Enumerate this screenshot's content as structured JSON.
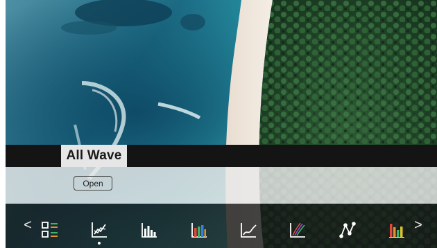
{
  "tile": {
    "title": "All Wave",
    "open_label": "Open"
  },
  "navigation": {
    "prev_label": "<",
    "next_label": ">"
  },
  "toolbar": {
    "selected_index": 1,
    "icons": [
      "list-view-icon",
      "line-chart-icon",
      "bar-chart-icon",
      "colored-bar-chart-icon",
      "curve-chart-icon",
      "multi-line-chart-icon",
      "network-graph-icon",
      "multicolor-bar-chart-icon"
    ]
  },
  "colors": {
    "title_band": "#141414",
    "title_tab": "#e6e6e6",
    "toolbar": "#161818",
    "accent_green": "#3fb36b",
    "accent_orange": "#e0932c",
    "accent_red": "#e2493a",
    "accent_blue": "#3a7de0",
    "accent_purple": "#8a4fd8",
    "accent_yellow": "#d9c431"
  }
}
